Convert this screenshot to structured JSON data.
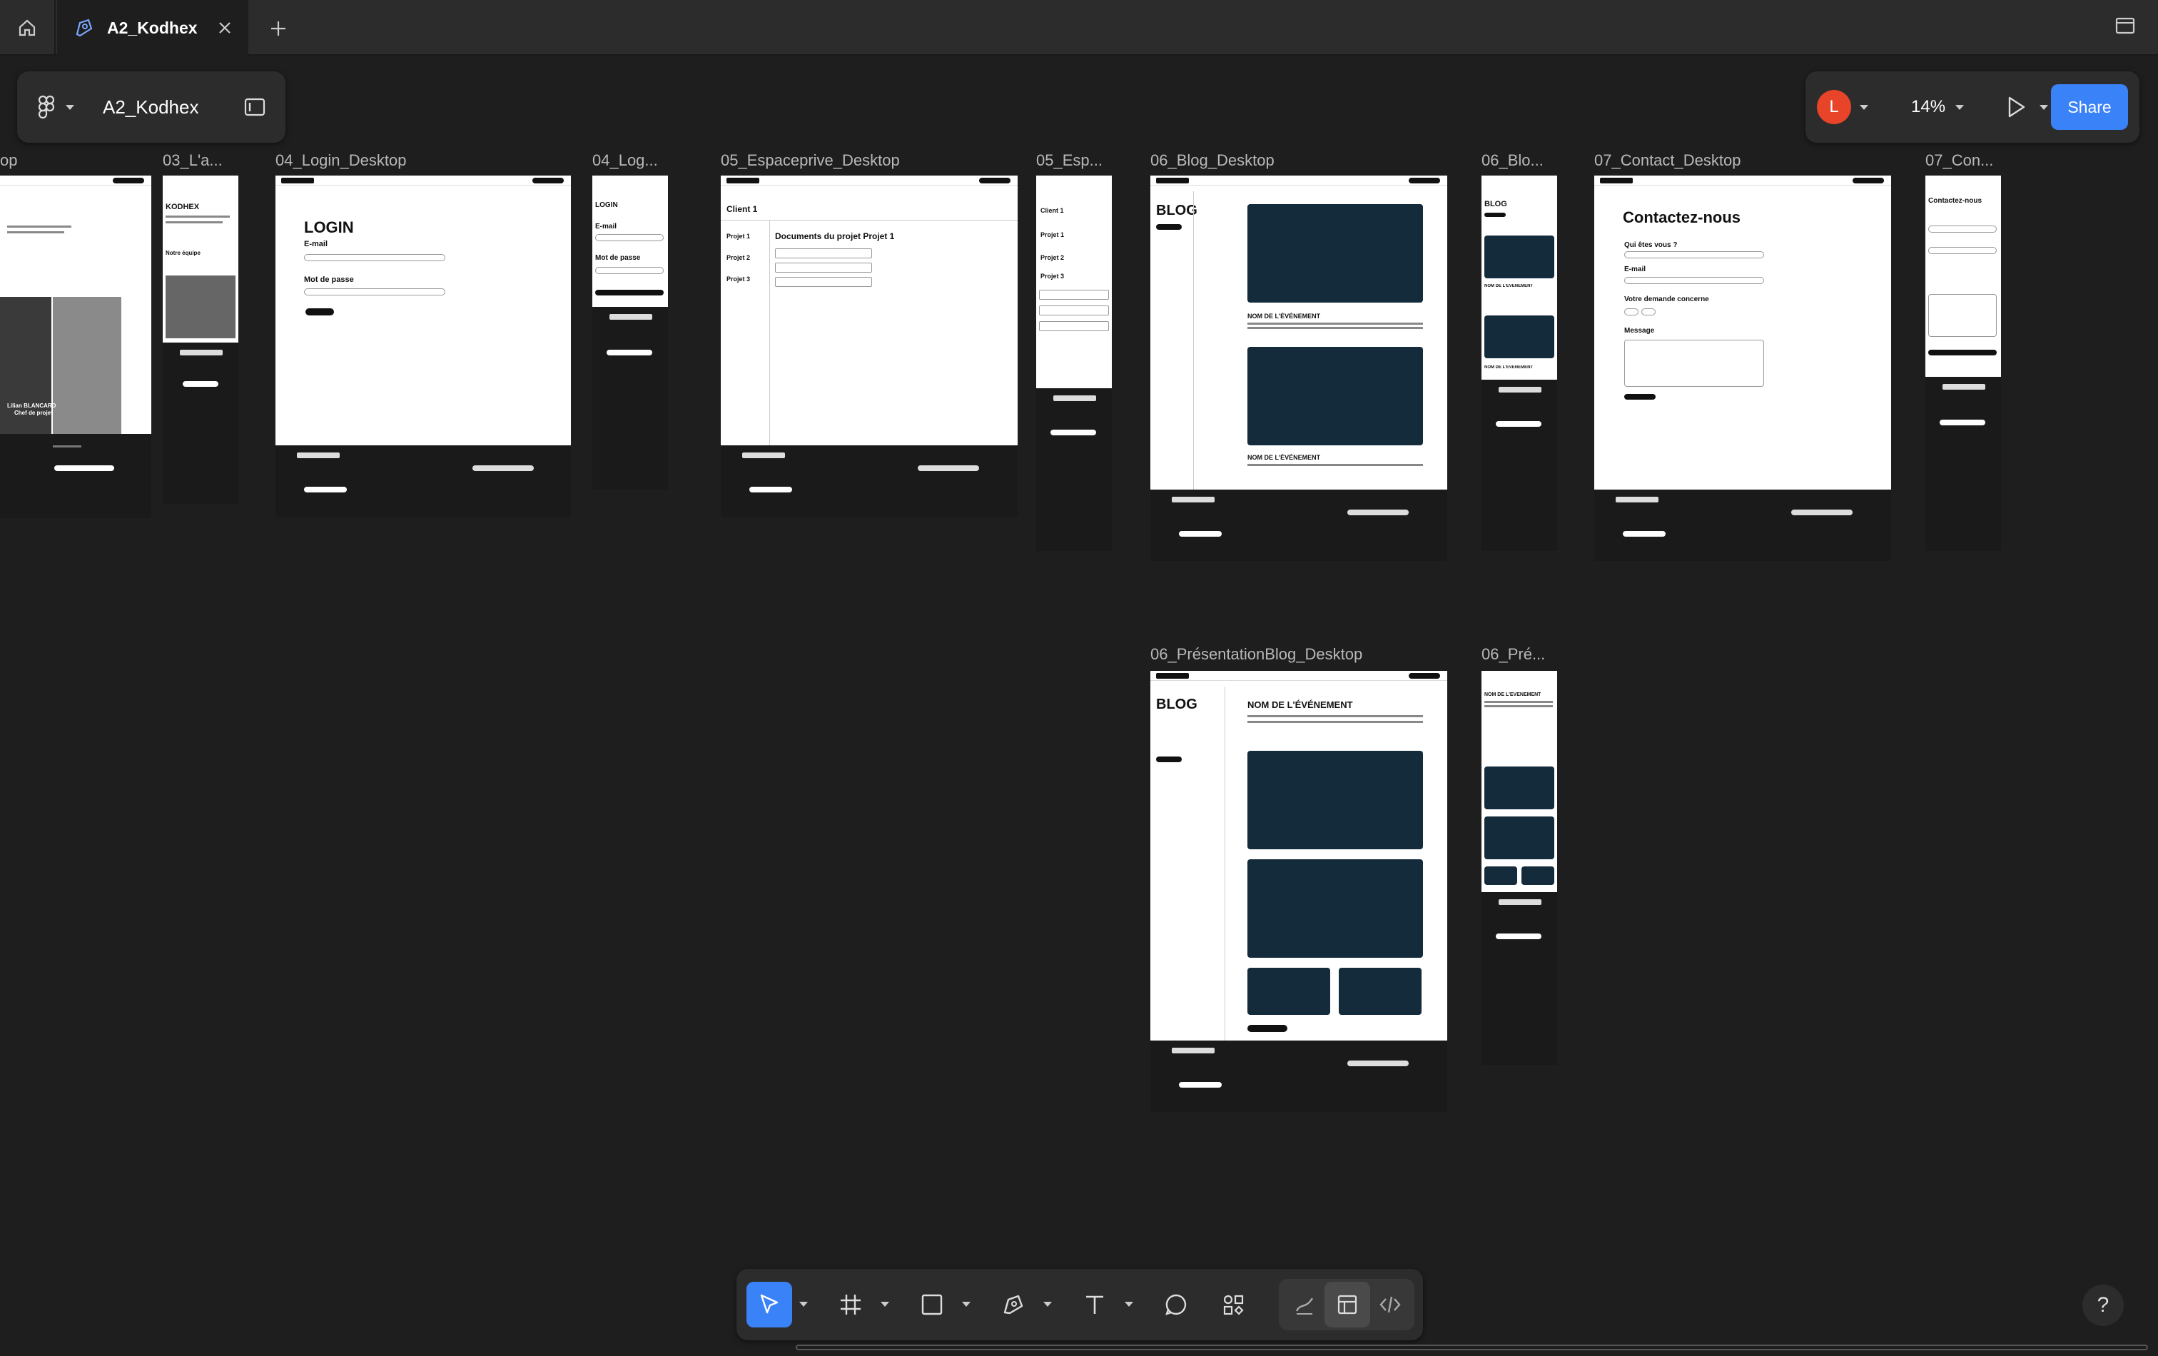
{
  "tabs": {
    "file_tab_title": "A2_Kodhex"
  },
  "file_panel": {
    "file_name": "A2_Kodhex"
  },
  "header_right": {
    "avatar_initial": "L",
    "zoom_level": "14%",
    "share_label": "Share"
  },
  "frames": {
    "f03_desktop_label": "op",
    "f03_mobile_label": "03_L'a...",
    "f04_desktop_label": "04_Login_Desktop",
    "f04_mobile_label": "04_Log...",
    "f05_desktop_label": "05_Espaceprive_Desktop",
    "f05_mobile_label": "05_Esp...",
    "f06_desktop_label": "06_Blog_Desktop",
    "f06_mobile_label": "06_Blo...",
    "f07_desktop_label": "07_Contact_Desktop",
    "f07_mobile_label": "07_Con...",
    "f06p_desktop_label": "06_PrésentationBlog_Desktop",
    "f06p_mobile_label": "06_Pré..."
  },
  "frame_content": {
    "kodhex": "KODHEX",
    "notre_equipe": "Notre équipe",
    "login": "LOGIN",
    "email": "E-mail",
    "mot_de_passe": "Mot de passe",
    "client": "Client 1",
    "projet1": "Projet 1",
    "projet2": "Projet 2",
    "projet3": "Projet 3",
    "documents": "Documents du projet Projet 1",
    "blog": "BLOG",
    "nom_event": "NOM DE L'ÉVÉNEMENT",
    "contactez": "Contactez-nous",
    "qui_etes_vous": "Qui êtes vous ?",
    "demande": "Votre demande concerne",
    "message": "Message",
    "person_name": "Lilian BLANCARD",
    "person_role": "Chef de projet"
  },
  "colors": {
    "canvas": "#1e1e1e",
    "panel": "#2c2c2c",
    "accent": "#3a82f7",
    "avatar": "#e8442a",
    "blog_image": "#142b3b"
  },
  "toolbar_icons": [
    "move-icon",
    "frame-icon",
    "rectangle-icon",
    "pen-icon",
    "text-icon",
    "comment-icon",
    "actions-icon",
    "draw-icon",
    "design-icon",
    "dev-mode-icon"
  ],
  "help_label": "?"
}
